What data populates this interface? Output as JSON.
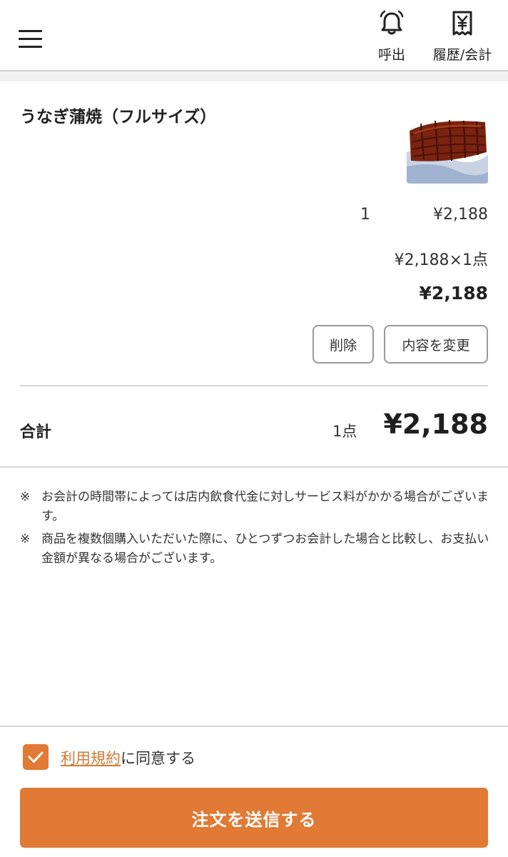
{
  "header": {
    "call_label": "呼出",
    "history_label": "履歴/会計"
  },
  "item": {
    "name": "うなぎ蒲焼（フルサイズ）",
    "image_icon": "grilled-eel-photo",
    "quantity": "1",
    "unit_price": "¥2,188",
    "calc": "¥2,188×1点",
    "subtotal": "¥2,188",
    "delete_label": "削除",
    "change_label": "内容を変更"
  },
  "total": {
    "label": "合計",
    "count": "1点",
    "amount": "¥2,188"
  },
  "notes": [
    {
      "mark": "※",
      "text": "お会計の時間帯によっては店内飲食代金に対しサービス料がかかる場合がございます。"
    },
    {
      "mark": "※",
      "text": "商品を複数個購入いただいた際に、ひとつずつお会計した場合と比較し、お支払い金額が異なる場合がございます。"
    }
  ],
  "footer": {
    "terms_link": "利用規約",
    "agree_suffix": "に同意する",
    "checkbox_checked": true,
    "submit_label": "注文を送信する"
  },
  "colors": {
    "accent": "#e07a34",
    "link": "#d07a35",
    "divider": "#d6d6d6"
  }
}
